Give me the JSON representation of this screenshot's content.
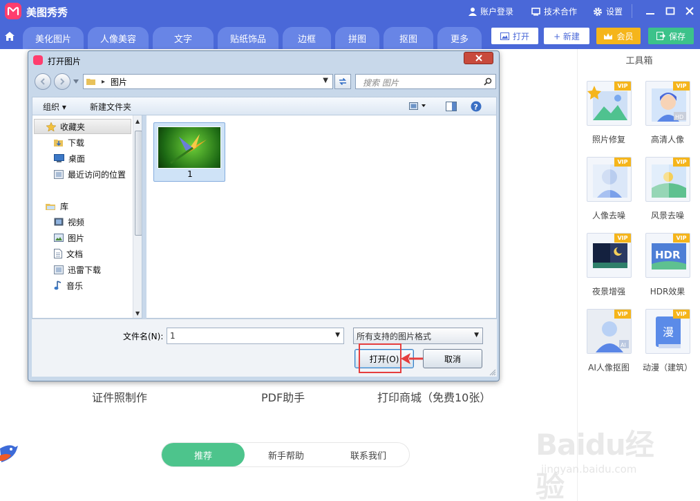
{
  "app": {
    "name": "美图秀秀"
  },
  "titlebar": {
    "account": "账户登录",
    "tech": "技术合作",
    "settings": "设置"
  },
  "tabs": [
    {
      "label": "美化图片"
    },
    {
      "label": "人像美容"
    },
    {
      "label": "文字"
    },
    {
      "label": "贴纸饰品"
    },
    {
      "label": "边框"
    },
    {
      "label": "拼图"
    },
    {
      "label": "抠图"
    },
    {
      "label": "更多"
    }
  ],
  "actions": {
    "open": "打开",
    "new": "+ 新建",
    "vip": "会员",
    "save": "保存"
  },
  "toolbox": {
    "title": "工具箱",
    "vip_badge": "VIP",
    "items": [
      {
        "label": "照片修复"
      },
      {
        "label": "高清人像"
      },
      {
        "label": "人像去噪"
      },
      {
        "label": "风景去噪"
      },
      {
        "label": "夜景增强"
      },
      {
        "label": "HDR效果"
      },
      {
        "label": "AI人像抠图"
      },
      {
        "label": "动漫（建筑）"
      }
    ],
    "hdr_text": "HDR",
    "hd_text": "HD",
    "ai_text": "AI",
    "anime_text": "漫"
  },
  "features": {
    "id_photo": "证件照制作",
    "pdf": "PDF助手",
    "print": "打印商城（免费10张）"
  },
  "bottom_tabs": [
    {
      "label": "推荐"
    },
    {
      "label": "新手帮助"
    },
    {
      "label": "联系我们"
    }
  ],
  "dialog": {
    "title": "打开图片",
    "address": "图片",
    "search_placeholder": "搜索 图片",
    "organize": "组织 ▾",
    "new_folder": "新建文件夹",
    "favorites": "收藏夹",
    "downloads": "下载",
    "desktop": "桌面",
    "recent": "最近访问的位置",
    "library": "库",
    "videos": "视频",
    "pictures": "图片",
    "documents": "文档",
    "thunder": "迅雷下载",
    "music": "音乐",
    "file_name": "1",
    "filename_label": "文件名(N):",
    "filename_value": "1",
    "filetype": "所有支持的图片格式",
    "open_btn": "打开(O)",
    "cancel_btn": "取消"
  },
  "watermark": {
    "logo": "Baidu经验",
    "url": "jingyan.baidu.com"
  },
  "colors": {
    "brand": "#4a68d8",
    "vip": "#f5b51b",
    "save": "#3cc28a",
    "accent_green": "#4dc48c",
    "highlight": "#e53d3d"
  }
}
